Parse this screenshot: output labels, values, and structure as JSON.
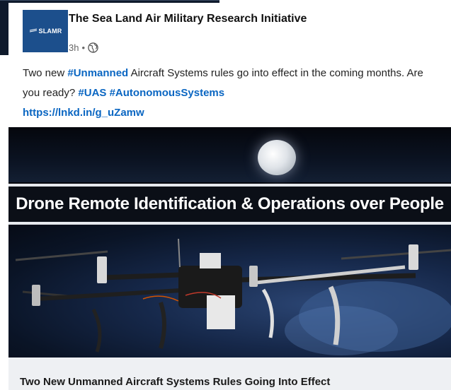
{
  "post": {
    "author": "The Sea Land Air Military Research Initiative",
    "avatar_text": "SLAMR",
    "time": "3h",
    "separator": "•",
    "text_part1": "Two new ",
    "tag1": "#Unmanned",
    "text_part2": " Aircraft Systems rules go into effect in the coming months. Are you ready? ",
    "tag2": "#UAS",
    "text_space": " ",
    "tag3": "#AutonomousSystems",
    "link": "https://lnkd.in/g_uZamw"
  },
  "media": {
    "banner_text": "Drone Remote Identification & Operations over People"
  },
  "link_preview": {
    "title": "Two New Unmanned Aircraft Systems Rules Going Into Effect"
  },
  "icons": {
    "globe": "globe-icon",
    "logo": "slamr-logo"
  },
  "colors": {
    "link": "#0a66c2",
    "text": "#222222",
    "avatar_bg": "#1c4f8c"
  }
}
